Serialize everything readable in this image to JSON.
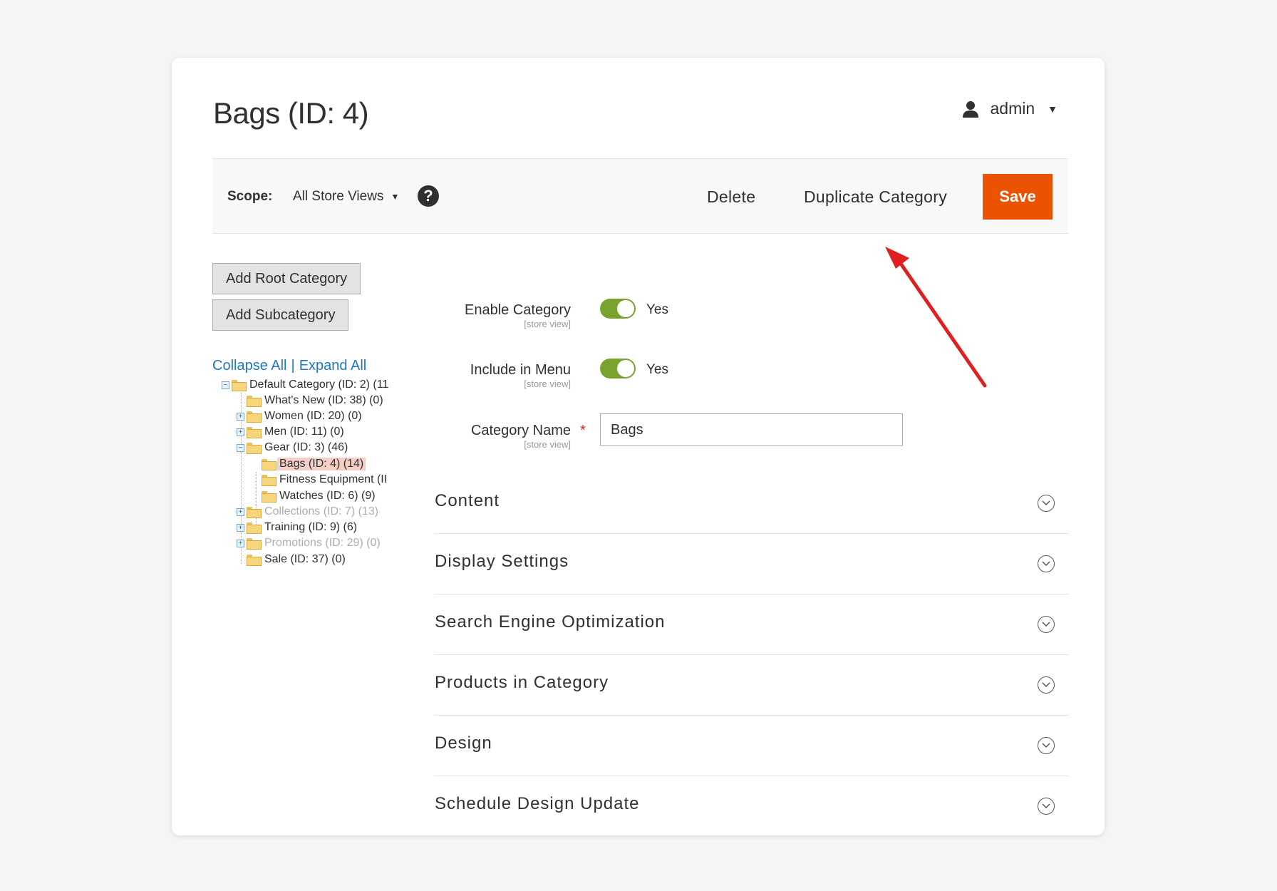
{
  "header": {
    "title": "Bags (ID: 4)",
    "user": "admin",
    "user_icon": "user-icon"
  },
  "toolbar": {
    "scope_label": "Scope:",
    "scope_value": "All Store Views",
    "help_icon": "help-icon",
    "help_glyph": "?",
    "delete_label": "Delete",
    "duplicate_label": "Duplicate Category",
    "save_label": "Save",
    "save_color": "#eb5202"
  },
  "tree_panel": {
    "add_root_label": "Add Root Category",
    "add_sub_label": "Add Subcategory",
    "collapse_label": "Collapse All",
    "separator": "|",
    "expand_label": "Expand All",
    "items": [
      {
        "label": "Default Category (ID: 2) (11",
        "state": "expanded"
      },
      {
        "label": "What's New (ID: 38) (0)",
        "state": "leaf"
      },
      {
        "label": "Women (ID: 20) (0)",
        "state": "collapsed"
      },
      {
        "label": "Men (ID: 11) (0)",
        "state": "collapsed"
      },
      {
        "label": "Gear (ID: 3) (46)",
        "state": "expanded"
      },
      {
        "label": "Bags (ID: 4) (14)",
        "state": "leaf",
        "selected": true
      },
      {
        "label": "Fitness Equipment (II",
        "state": "leaf"
      },
      {
        "label": "Watches (ID: 6) (9)",
        "state": "leaf"
      },
      {
        "label": "Collections (ID: 7) (13)",
        "state": "collapsed",
        "disabled": true
      },
      {
        "label": "Training (ID: 9) (6)",
        "state": "collapsed"
      },
      {
        "label": "Promotions (ID: 29) (0)",
        "state": "collapsed",
        "disabled": true
      },
      {
        "label": "Sale (ID: 37) (0)",
        "state": "leaf"
      }
    ]
  },
  "form": {
    "enable_label": "Enable Category",
    "enable_scope": "[store view]",
    "enable_value": "Yes",
    "enable_on": true,
    "menu_label": "Include in Menu",
    "menu_scope": "[store view]",
    "menu_value": "Yes",
    "menu_on": true,
    "name_label": "Category Name",
    "name_required": "*",
    "name_scope": "[store view]",
    "name_value": "Bags"
  },
  "sections": [
    {
      "title": "Content"
    },
    {
      "title": "Display Settings"
    },
    {
      "title": "Search Engine Optimization"
    },
    {
      "title": "Products in Category"
    },
    {
      "title": "Design"
    },
    {
      "title": "Schedule Design Update"
    }
  ],
  "annotation": {
    "arrow_color": "#e02020",
    "points_to": "Duplicate Category"
  }
}
